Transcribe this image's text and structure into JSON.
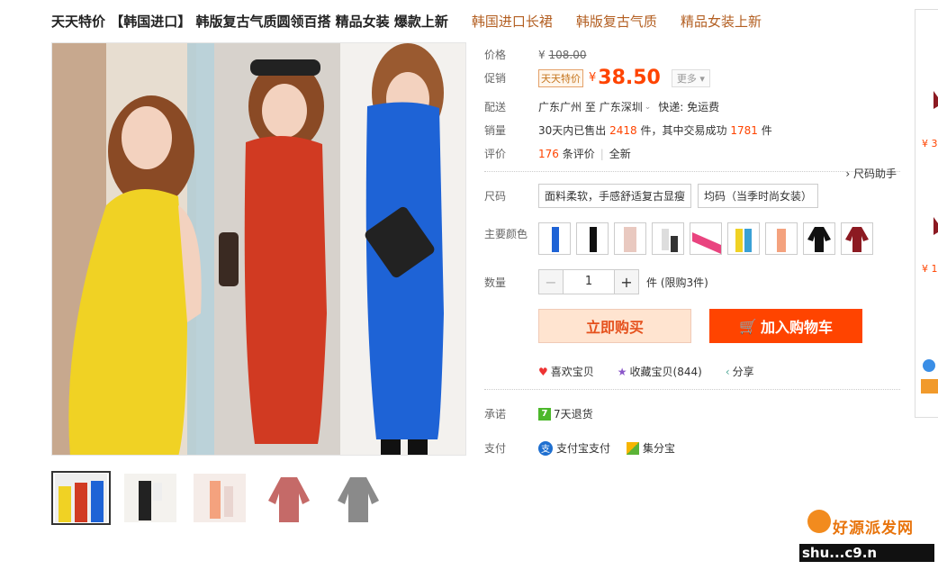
{
  "title": {
    "main": "天天特价 【韩国进口】 韩版复古气质圆领百搭 精品女装 爆款上新",
    "tags": [
      "韩国进口长裙",
      "韩版复古气质",
      "精品女装上新"
    ]
  },
  "price": {
    "label": "价格",
    "currency": "¥",
    "original": "108.00"
  },
  "promo": {
    "label": "促销",
    "tag": "天天特价",
    "currency": "¥",
    "price": "38.50",
    "more": "更多"
  },
  "shipping": {
    "label": "配送",
    "from": "广东广州",
    "to_word": "至",
    "to": "广东深圳",
    "method": "快递: 免运费"
  },
  "sales": {
    "label": "销量",
    "prefix": "30天内已售出",
    "sold": "2418",
    "mid": "件，其中交易成功",
    "success": "1781",
    "suffix": "件"
  },
  "reviews": {
    "label": "评价",
    "count": "176",
    "count_suffix": "条评价",
    "all": "全新"
  },
  "size_helper": "尺码助手",
  "size": {
    "label": "尺码",
    "options": [
      "面料柔软，手感舒适复古显瘦",
      "均码（当季时尚女装）"
    ]
  },
  "colors": {
    "label": "主要颜色",
    "swatches": [
      "blue",
      "black",
      "pink-print",
      "white-black",
      "pink",
      "yellow-blue",
      "orange",
      "black-top",
      "red-top"
    ]
  },
  "quantity": {
    "label": "数量",
    "value": "1",
    "unit": "件 (限购3件)"
  },
  "buttons": {
    "buy_now": "立即购买",
    "add_cart": "加入购物车"
  },
  "actions": {
    "like": "喜欢宝贝",
    "favorite": "收藏宝贝(844)",
    "share": "分享"
  },
  "promise": {
    "label": "承诺",
    "badge": "7",
    "text": "7天退货"
  },
  "payment": {
    "label": "支付",
    "alipay": "支付宝支付",
    "jifen": "集分宝"
  },
  "sidebar": {
    "price1": "¥ 3",
    "price2": "¥ 1"
  },
  "watermark": {
    "top": "好源派发网",
    "bottom": "shu...c9.n"
  },
  "colors_theme": {
    "accent": "#ff4400",
    "tag_brown": "#b35f22"
  }
}
